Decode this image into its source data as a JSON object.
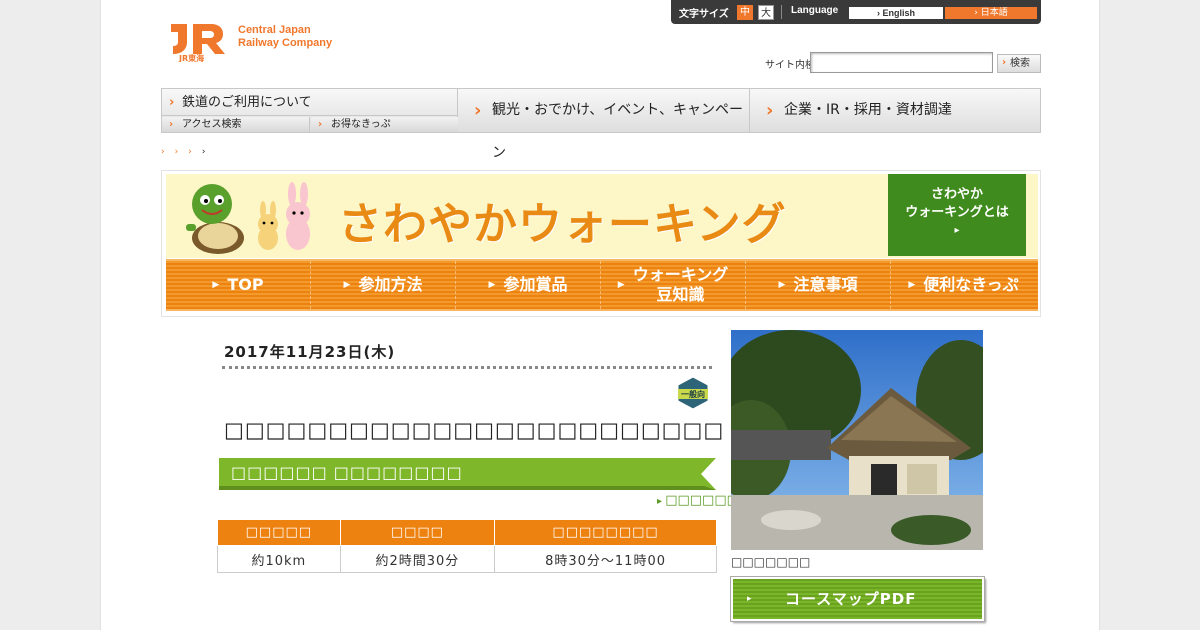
{
  "header": {
    "logo_mark_text": "JR東海",
    "logo_text_line1": "Central Japan",
    "logo_text_line2": "Railway Company",
    "font_size_label": "文字サイズ",
    "font_size_mid": "中",
    "font_size_large": "大",
    "language_label": "Language",
    "lang_english": "› English",
    "lang_japanese": "› 日本語",
    "search_label": "サイト内検索",
    "search_value": "",
    "search_button": "検索"
  },
  "gnav": {
    "rail_main": "鉄道のご利用について",
    "rail_sub1": "アクセス検索",
    "rail_sub2": "お得なきっぷ",
    "tour": "観光・おでかけ、イベント、キャンペーン",
    "corp": "企業・IR・採用・資材調達"
  },
  "breadcrumb": {
    "items": [
      "›",
      "›",
      "›",
      "›"
    ]
  },
  "banner": {
    "title": "さわやかウォーキング",
    "about_line1": "さわやか",
    "about_line2": "ウォーキングとは",
    "about_arrow": "▸"
  },
  "subnav": {
    "items": [
      {
        "label": "TOP"
      },
      {
        "label": "参加方法"
      },
      {
        "label": "参加賞品"
      },
      {
        "label": "ウォーキング\n豆知識"
      },
      {
        "label": "注意事項"
      },
      {
        "label": "便利なきっぷ"
      }
    ]
  },
  "event": {
    "date": "2017年11月23日(木)",
    "badge": "一般向",
    "title": "□□□□□□□□□□□□□□□□□□□□□□□□",
    "course_name": "□□□□□□ □□□□□□□□",
    "detail_link": "□□□□□□□",
    "table_headers": [
      "□□□□□",
      "□□□□",
      "□□□□□□□□"
    ],
    "table_values": [
      "約10km",
      "約2時間30分",
      "8時30分～11時00"
    ],
    "photo_caption": "□□□□□□□",
    "pdf_button": "コースマップPDF",
    "pdf_arrow": "▸"
  },
  "colors": {
    "accent_orange": "#ee8210",
    "jr_orange": "#f0782d",
    "green": "#6aa21f"
  }
}
